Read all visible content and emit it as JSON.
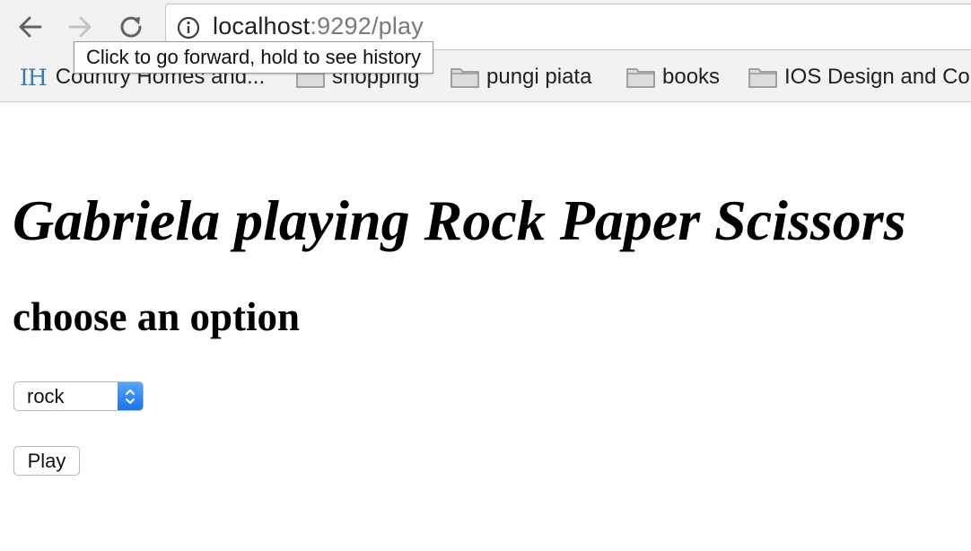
{
  "browser": {
    "url_host": "localhost",
    "url_rest": ":9292/play",
    "tooltip": "Click to go forward, hold to see history",
    "icons": {
      "back": "back-arrow-icon",
      "forward": "forward-arrow-icon",
      "reload": "reload-icon",
      "info": "info-icon",
      "folder": "folder-icon"
    },
    "bookmarks": [
      {
        "icon": "IH",
        "label": "Country Homes and..."
      },
      {
        "label": "shopping"
      },
      {
        "label": "pungi piata"
      },
      {
        "label": "books"
      },
      {
        "label": "IOS Design and Co"
      }
    ]
  },
  "page": {
    "title": "Gabriela playing Rock Paper Scissors",
    "subtitle": "choose an option",
    "select": {
      "selected": "rock"
    },
    "play_label": "Play"
  },
  "colors": {
    "select_accent": "#1a73e8",
    "ih_logo": "#3d7aa8"
  }
}
